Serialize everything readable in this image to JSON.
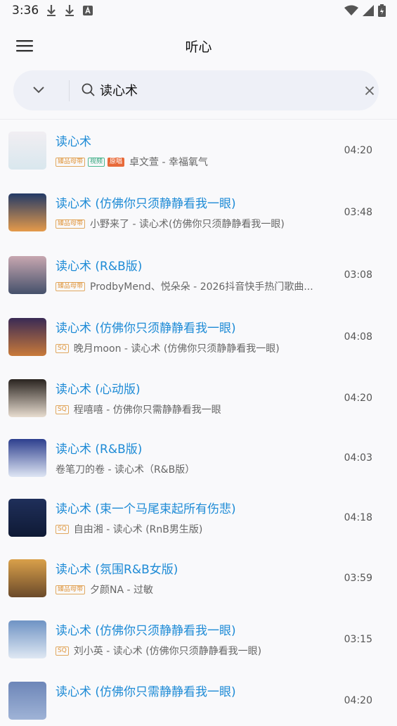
{
  "status": {
    "time": "3:36"
  },
  "app": {
    "title": "听心"
  },
  "search": {
    "value": "读心术",
    "placeholder": ""
  },
  "songs": [
    {
      "title": "读心术",
      "badges": [
        {
          "text": "臻品母带",
          "kind": "gold"
        },
        {
          "text": "视频",
          "kind": "green"
        },
        {
          "text": "原唱",
          "kind": "orange"
        }
      ],
      "artist_album": "卓文萱 - 幸福氧气",
      "duration": "04:20",
      "cover": {
        "top": "#f1eef2",
        "bottom": "#d9e7ee"
      }
    },
    {
      "title": "读心术 (仿佛你只须静静看我一眼)",
      "badges": [
        {
          "text": "臻品母带",
          "kind": "gold"
        }
      ],
      "artist_album": "小野来了 - 读心术(仿佛你只须静静看我一眼)",
      "duration": "03:48",
      "cover": {
        "top": "#233a67",
        "bottom": "#e59a4a"
      }
    },
    {
      "title": "读心术 (R&B版)",
      "badges": [
        {
          "text": "臻品母带",
          "kind": "gold"
        }
      ],
      "artist_album": "ProdbyMend、悦朵朵 - 2026抖音快手热门歌曲...",
      "duration": "03:08",
      "cover": {
        "top": "#c7a7b0",
        "bottom": "#45516b"
      }
    },
    {
      "title": "读心术 (仿佛你只须静静看我一眼)",
      "badges": [
        {
          "text": "SQ",
          "kind": "gold"
        }
      ],
      "artist_album": "晚月moon - 读心术 (仿佛你只须静静看我一眼)",
      "duration": "04:08",
      "cover": {
        "top": "#3a2a55",
        "bottom": "#c97a3a"
      }
    },
    {
      "title": "读心术 (心动版)",
      "badges": [
        {
          "text": "SQ",
          "kind": "gold"
        }
      ],
      "artist_album": "程嘻嘻 - 仿佛你只需静静看我一眼",
      "duration": "04:20",
      "cover": {
        "top": "#2a2420",
        "bottom": "#e8ddd0"
      }
    },
    {
      "title": "读心术 (R&B版)",
      "badges": [],
      "artist_album": "卷笔刀的卷 - 读心术（R&B版）",
      "duration": "04:03",
      "cover": {
        "top": "#2d3f8e",
        "bottom": "#dfe6f4"
      }
    },
    {
      "title": "读心术 (束一个马尾束起所有伤悲)",
      "badges": [
        {
          "text": "SQ",
          "kind": "gold"
        }
      ],
      "artist_album": "自由湘 - 读心术 (RnB男生版)",
      "duration": "04:18",
      "cover": {
        "top": "#1f2f5a",
        "bottom": "#0f1a35"
      }
    },
    {
      "title": "读心术 (氛围R&B女版)",
      "badges": [
        {
          "text": "臻品母带",
          "kind": "gold"
        }
      ],
      "artist_album": "夕颜NA - 过敏",
      "duration": "03:59",
      "cover": {
        "top": "#d9a04a",
        "bottom": "#6b4a2a"
      }
    },
    {
      "title": "读心术 (仿佛你只须静静看我一眼)",
      "badges": [
        {
          "text": "SQ",
          "kind": "gold"
        }
      ],
      "artist_album": "刘小英 - 读心术 (仿佛你只须静静看我一眼)",
      "duration": "03:15",
      "cover": {
        "top": "#6f93c4",
        "bottom": "#dfe8f3"
      }
    },
    {
      "title": "读心术 (仿佛你只需静静看我一眼)",
      "badges": [],
      "artist_album": "",
      "duration": "04:20",
      "cover": {
        "top": "#6d86b8",
        "bottom": "#9fb3d6"
      }
    }
  ],
  "colors": {
    "accent": "#1e8bd6",
    "background": "#f9f9fb"
  },
  "icons": {
    "menu": "hamburger-menu-icon",
    "collapse": "chevron-down-icon",
    "search": "search-icon",
    "clear": "close-icon"
  }
}
